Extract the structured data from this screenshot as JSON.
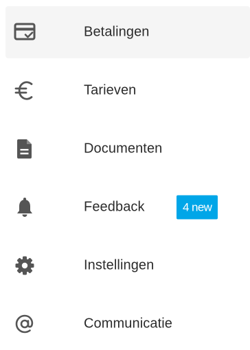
{
  "colors": {
    "icon": "#555555",
    "text": "#2b2b2b",
    "active_background": "#f5f5f5",
    "badge_background": "#00a6e8",
    "badge_text": "#ffffff"
  },
  "nav": {
    "items": [
      {
        "label": "Betalingen",
        "icon": "payment-card-check-icon",
        "active": true
      },
      {
        "label": "Tarieven",
        "icon": "euro-icon"
      },
      {
        "label": "Documenten",
        "icon": "document-icon"
      },
      {
        "label": "Feedback",
        "icon": "bell-icon",
        "badge": "4 new"
      },
      {
        "label": "Instellingen",
        "icon": "gear-icon"
      },
      {
        "label": "Communicatie",
        "icon": "at-sign-icon"
      }
    ]
  }
}
